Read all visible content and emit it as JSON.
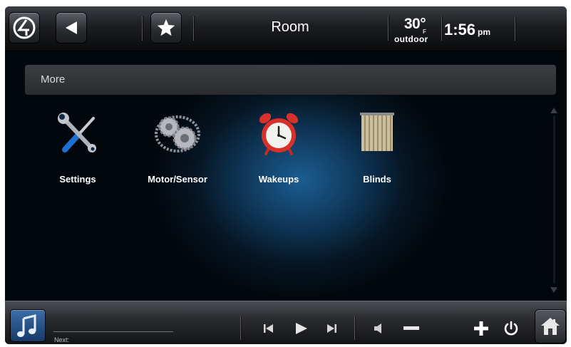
{
  "topbar": {
    "room_title": "Room",
    "temperature": "30°",
    "temperature_unit": "F",
    "temperature_label": "outdoor",
    "time": "1:56",
    "ampm": "pm"
  },
  "section": {
    "title": "More"
  },
  "tiles": [
    {
      "label": "Settings",
      "icon": "settings-icon"
    },
    {
      "label": "Motor/Sensor",
      "icon": "gears-icon"
    },
    {
      "label": "Wakeups",
      "icon": "alarm-clock-icon"
    },
    {
      "label": "Blinds",
      "icon": "blinds-icon"
    }
  ],
  "bottombar": {
    "next_label": "Next:"
  },
  "colors": {
    "background": "#030508",
    "accent_glow": "#1b5d91",
    "text": "#ffffff"
  }
}
